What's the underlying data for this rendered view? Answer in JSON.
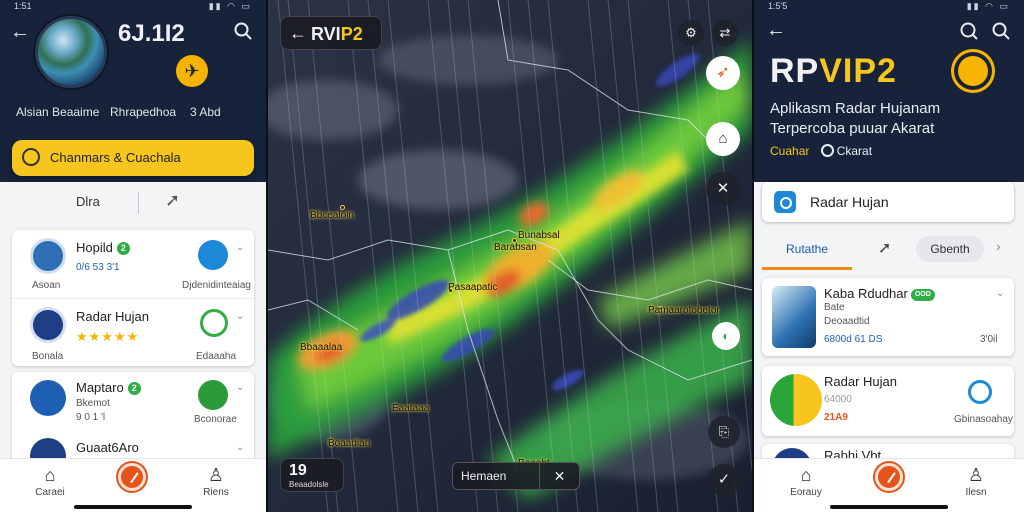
{
  "panel1": {
    "status_time": "1:51",
    "title": "6J.1I2",
    "sub_left": "Alsian Beaaime",
    "sub_mid": "Rhrapedhoa",
    "sub_right": "3 Abd",
    "yellow_bar_label": "Chanmars & Cuachala",
    "tab1_label": "Dlra",
    "list1": [
      {
        "name": "Hopild",
        "badge": "2",
        "sub": "0/6 53 3'1",
        "caption": "Asoan",
        "right_caption": "Djdenidinteaiag"
      },
      {
        "name": "Radar Hujan",
        "stars": "★★★★★",
        "caption": "Bonala",
        "right_caption": "Edaaaha"
      }
    ],
    "list2": [
      {
        "name": "Maptaro",
        "badge": "2",
        "sub": "Bkemot",
        "sub2": "9 0 1 'l",
        "right_caption": "Bconorae"
      },
      {
        "name": "Guaat6Aro"
      }
    ],
    "nav": [
      {
        "label": "Caraei",
        "icon": "home-icon"
      },
      {
        "label": "",
        "icon": "record-icon"
      },
      {
        "label": "Riens",
        "icon": "profile-icon"
      }
    ]
  },
  "panel2": {
    "title_a": "RVI",
    "title_b": "P2",
    "time_number": "19",
    "time_sub": "Beaadolsle",
    "play_label": "Hemaen",
    "cities": [
      "Bbcealoin",
      "Barabsan",
      "Bunabsal",
      "Pasaapatic",
      "Bbaaalaa",
      "Boaadian",
      "Eaataaa",
      "Pamaarotobetor",
      "Beaebt"
    ],
    "colors": {
      "accent": "#f7c61e"
    }
  },
  "panel3": {
    "status_time": "1:5'5",
    "title_a": "RP",
    "title_b": "VIP2",
    "sub_line1": "Aplikasm Radar Hujanam",
    "sub_line2": "Terpercoba puuar Akarat",
    "link_a": "Cuahar",
    "link_b": "Ckarat",
    "search_label": "Radar Hujan",
    "tab_active": "Rutathe",
    "tab_pill": "Gbenth",
    "cards": [
      {
        "name": "Kaba Rdudhar",
        "badge": "OOD",
        "sub1": "Bate",
        "sub2": "Deoaadtid",
        "meta": "6800d 61 DS",
        "meta_right": "3'0il"
      },
      {
        "name": "Radar Hujan",
        "sub1": "64000",
        "sub2": "21A9",
        "right_caption": "Gbinasoahay"
      },
      {
        "name": "Rabhi Vbt"
      }
    ],
    "nav": [
      {
        "label": "Eorauy",
        "icon": "home-icon"
      },
      {
        "label": "",
        "icon": "record-icon"
      },
      {
        "label": "Ilesn",
        "icon": "profile-icon"
      }
    ],
    "colors": {
      "accent": "#f08a1a",
      "brand": "#f7c61e"
    }
  }
}
